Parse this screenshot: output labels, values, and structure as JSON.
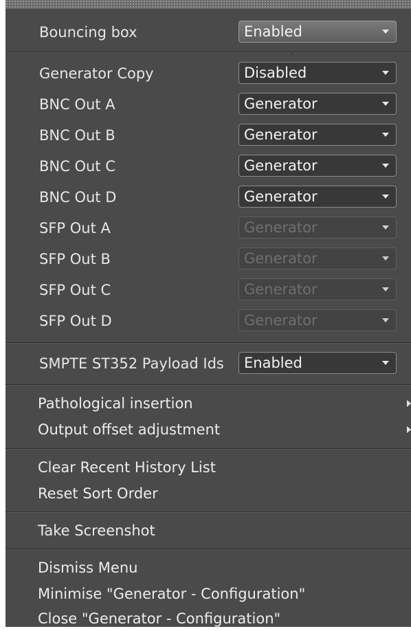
{
  "settings": {
    "bouncing_box": {
      "label": "Bouncing box",
      "value": "Enabled"
    },
    "outputs": [
      {
        "label": "Generator Copy",
        "value": "Disabled"
      },
      {
        "label": "BNC Out A",
        "value": "Generator"
      },
      {
        "label": "BNC Out B",
        "value": "Generator"
      },
      {
        "label": "BNC Out C",
        "value": "Generator"
      },
      {
        "label": "BNC Out D",
        "value": "Generator"
      },
      {
        "label": "SFP Out A",
        "value": "Generator"
      },
      {
        "label": "SFP Out B",
        "value": "Generator"
      },
      {
        "label": "SFP Out C",
        "value": "Generator"
      },
      {
        "label": "SFP Out D",
        "value": "Generator"
      }
    ],
    "payload_ids": {
      "label": "SMPTE ST352 Payload Ids",
      "value": "Enabled"
    }
  },
  "menu": {
    "submenus": [
      {
        "label": "Pathological insertion"
      },
      {
        "label": "Output offset adjustment"
      }
    ],
    "history": [
      {
        "label": "Clear Recent History List"
      },
      {
        "label": "Reset Sort Order"
      }
    ],
    "screenshot": {
      "label": "Take Screenshot"
    },
    "window": [
      {
        "label": "Dismiss Menu"
      },
      {
        "label": "Minimise \"Generator - Configuration\""
      },
      {
        "label": "Close \"Generator - Configuration\""
      }
    ]
  }
}
